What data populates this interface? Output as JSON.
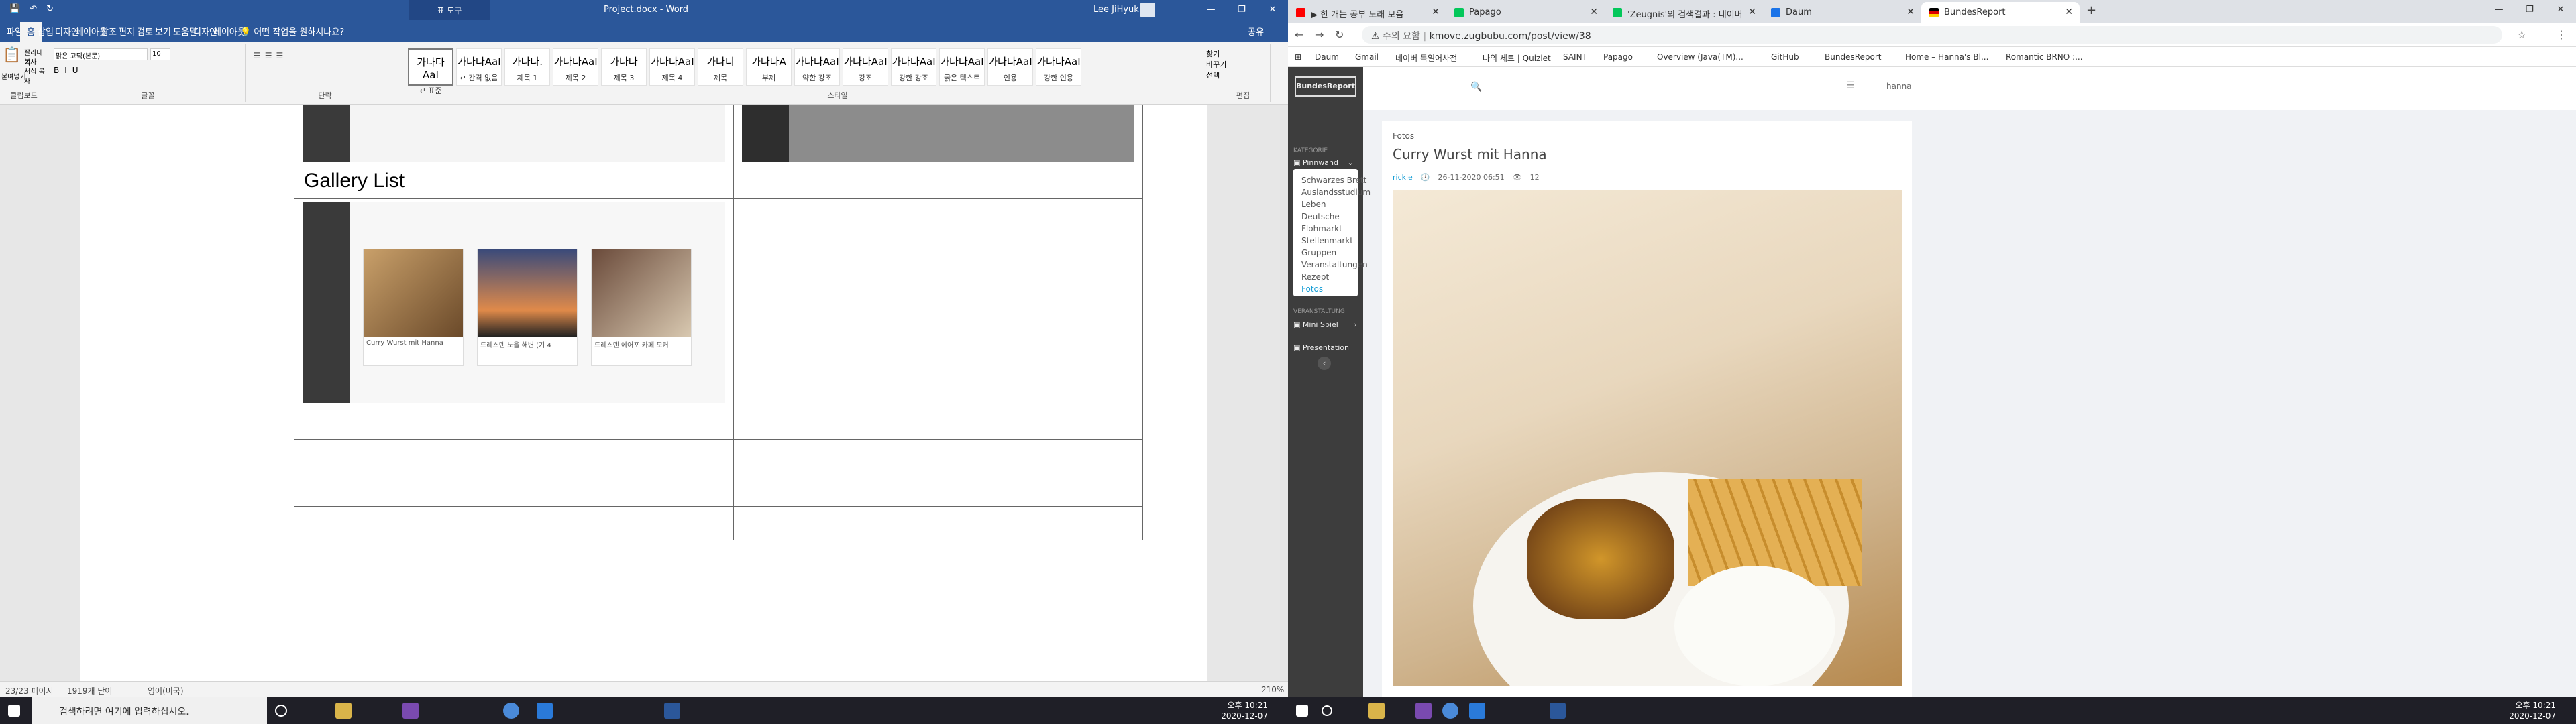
{
  "word": {
    "title": {
      "doc_title": "Project.docx - Word",
      "tool_tab": "표 도구",
      "user": "Lee JiHyuk",
      "min": "—",
      "restore": "❐",
      "close": "✕"
    },
    "tabs": [
      {
        "label": "파일"
      },
      {
        "label": "홈"
      },
      {
        "label": "삽입"
      },
      {
        "label": "디자인"
      },
      {
        "label": "레이아웃"
      },
      {
        "label": "참조"
      },
      {
        "label": "편지"
      },
      {
        "label": "검토"
      },
      {
        "label": "보기"
      },
      {
        "label": "도움말"
      },
      {
        "label": "디자인"
      },
      {
        "label": "레이아웃"
      }
    ],
    "tell_me": "어떤 작업을 원하시나요?",
    "share": "공유",
    "clipboard": {
      "paste": "붙여넣기",
      "cut": "잘라내기",
      "copy": "복사",
      "format_painter": "서식 복사",
      "label": "클립보드"
    },
    "font": {
      "name": "맑은 고딕(본문)",
      "size": "10",
      "label": "글꼴"
    },
    "paragraph_label": "단락",
    "styles_label": "스타일",
    "styles": [
      {
        "sample": "가나다AaI",
        "name": "↵ 표준"
      },
      {
        "sample": "가나다AaI",
        "name": "↵ 간격 없음"
      },
      {
        "sample": "가나다.",
        "name": "제목 1"
      },
      {
        "sample": "가나다AaI",
        "name": "제목 2"
      },
      {
        "sample": "가나다",
        "name": "제목 3"
      },
      {
        "sample": "가나다AaI",
        "name": "제목 4"
      },
      {
        "sample": "가나디",
        "name": "제목"
      },
      {
        "sample": "가나다A",
        "name": "부제"
      },
      {
        "sample": "가나다AaI",
        "name": "약한 강조"
      },
      {
        "sample": "가나다AaI",
        "name": "강조"
      },
      {
        "sample": "가나다AaI",
        "name": "강한 강조"
      },
      {
        "sample": "가나다AaI",
        "name": "굵은 텍스트"
      },
      {
        "sample": "가나다AaI",
        "name": "인용"
      },
      {
        "sample": "가나다AaI",
        "name": "강한 인용"
      }
    ],
    "editing": {
      "find": "찾기",
      "replace": "바꾸기",
      "select": "선택",
      "label": "편집"
    },
    "document": {
      "gallery_title": "Gallery List",
      "mini_cards": [
        {
          "caption": "Curry Wurst mit Hanna"
        },
        {
          "caption": "드레스덴 노을 해변 (기 4"
        },
        {
          "caption": "드레스덴 에어포 카페 모커"
        }
      ]
    },
    "status": {
      "page": "23/23 페이지",
      "words": "1919개 단어",
      "lang": "영어(미국)",
      "zoom": "210%"
    }
  },
  "taskbar_left": {
    "search_placeholder": "검색하려면 여기에 입력하십시오.",
    "time": "오후 10:21",
    "date": "2020-12-07"
  },
  "chrome": {
    "tabs": [
      {
        "title": "▶ 한 개는 공부 노래 모음",
        "color": "#ff0000"
      },
      {
        "title": "Papago",
        "color": "#03c75a"
      },
      {
        "title": "'Zeugnis'의 검색결과 : 네이버",
        "color": "#03c75a"
      },
      {
        "title": "Daum",
        "color": "#1a73e8"
      },
      {
        "title": "BundesReport",
        "color": "#dd0000"
      }
    ],
    "url": "kmove.zugbubu.com/post/view/38",
    "security_note": "주의 요함",
    "bookmarks": [
      {
        "label": "Daum"
      },
      {
        "label": "Gmail"
      },
      {
        "label": "네이버 독일어사전"
      },
      {
        "label": "나의 세트 | Quizlet"
      },
      {
        "label": "SAINT"
      },
      {
        "label": "Papago"
      },
      {
        "label": "Overview (Java(TM)..."
      },
      {
        "label": "GitHub"
      },
      {
        "label": "BundesReport"
      },
      {
        "label": "Home – Hanna's Bl..."
      },
      {
        "label": "Romantic BRNO :..."
      }
    ]
  },
  "site": {
    "logo": "BundesReport",
    "category_heading": "KATEGORIE",
    "current_category": "Pinnwand",
    "menu": [
      {
        "label": "Schwarzes Brett"
      },
      {
        "label": "Auslandsstudium"
      },
      {
        "label": "Leben"
      },
      {
        "label": "Deutsche"
      },
      {
        "label": "Flohmarkt"
      },
      {
        "label": "Stellenmarkt"
      },
      {
        "label": "Gruppen"
      },
      {
        "label": "Veranstaltungen"
      },
      {
        "label": "Rezept"
      },
      {
        "label": "Fotos"
      }
    ],
    "secondary_heading": "VERANSTALTUNG",
    "mini_spiel": "Mini Spiel",
    "presentation": "Presentation",
    "user": "hanna",
    "post": {
      "category": "Fotos",
      "title": "Curry Wurst mit Hanna",
      "author": "rickie",
      "date": "26-11-2020 06:51",
      "views": "12"
    }
  },
  "taskbar_right": {
    "time": "오후 10:21",
    "date": "2020-12-07"
  },
  "colors": {
    "word_blue": "#2b579a",
    "taskbar": "#1f1f27",
    "sidebar": "#3d3d3d",
    "active_link": "#1a9fd6"
  }
}
